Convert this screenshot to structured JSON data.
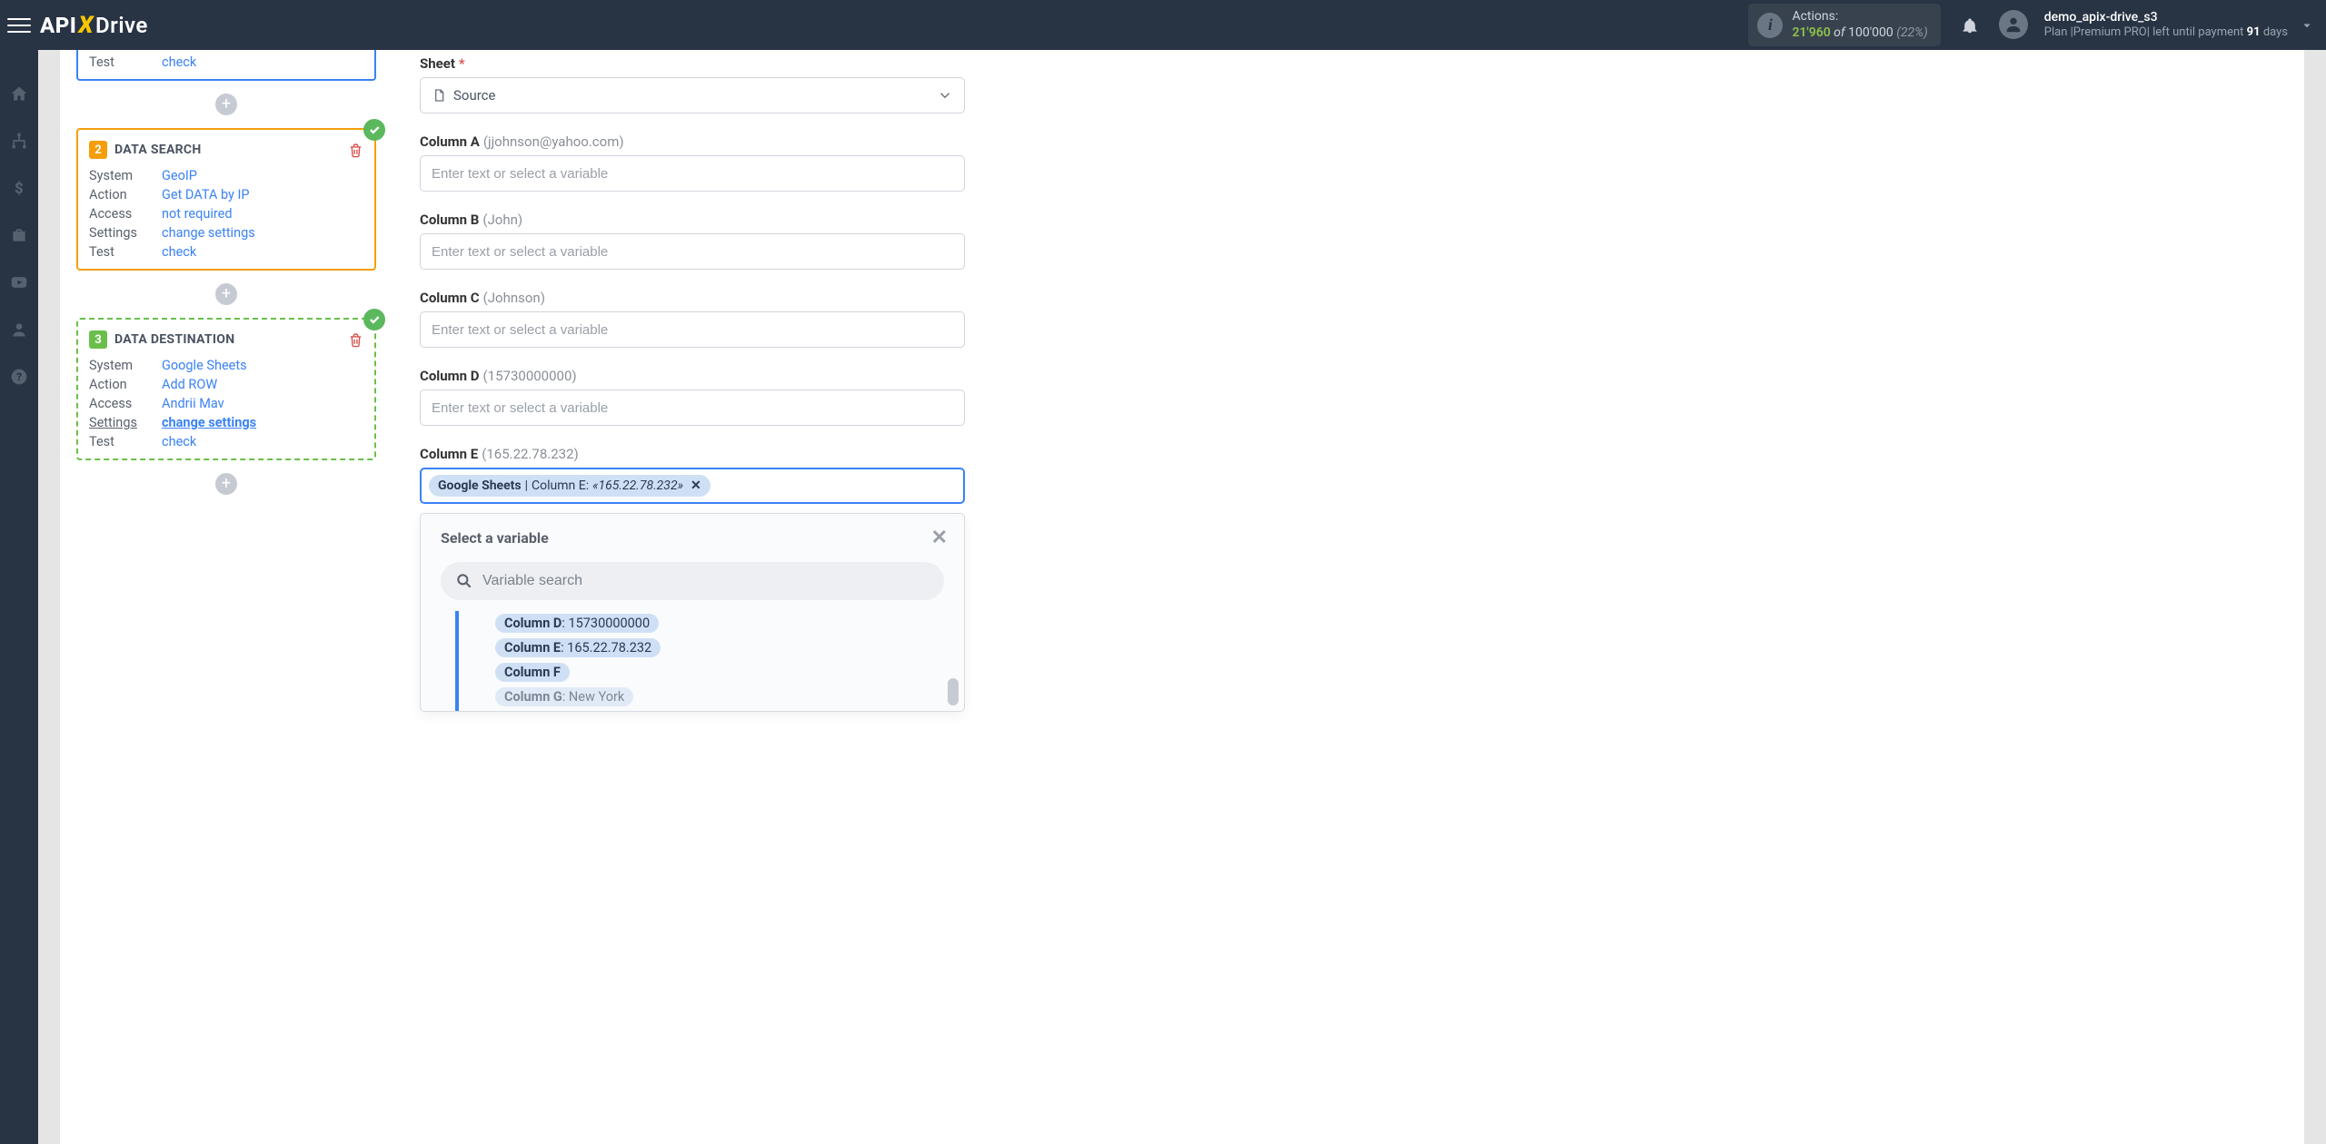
{
  "header": {
    "logo_api": "API",
    "logo_drive": "Drive",
    "actions_label": "Actions:",
    "actions_count": "21'960",
    "actions_of": " of ",
    "actions_total": "100'000",
    "actions_pct": " (22%)",
    "user_name": "demo_apix-drive_s3",
    "user_plan_prefix": "Plan |",
    "user_plan_name": "Premium PRO",
    "user_plan_suffix": "| left until payment ",
    "user_plan_days": "91",
    "user_plan_days_unit": " days"
  },
  "sidebar_icons": [
    "home",
    "sitemap",
    "dollar",
    "briefcase",
    "youtube",
    "user",
    "help"
  ],
  "card1": {
    "test_k": "Test",
    "test_v": "check"
  },
  "card2": {
    "num": "2",
    "title": "DATA SEARCH",
    "rows": {
      "system_k": "System",
      "system_v": "GeoIP",
      "action_k": "Action",
      "action_v": "Get DATA by IP",
      "access_k": "Access",
      "access_v": "not required",
      "settings_k": "Settings",
      "settings_v": "change settings",
      "test_k": "Test",
      "test_v": "check"
    }
  },
  "card3": {
    "num": "3",
    "title": "DATA DESTINATION",
    "rows": {
      "system_k": "System",
      "system_v": "Google Sheets",
      "action_k": "Action",
      "action_v": "Add ROW",
      "access_k": "Access",
      "access_v": "Andrii Mav",
      "settings_k": "Settings",
      "settings_v": "change settings",
      "test_k": "Test",
      "test_v": "check"
    }
  },
  "form": {
    "sheet_label": "Sheet",
    "sheet_value": "Source",
    "placeholder": "Enter text or select a variable",
    "colA_label": "Column A",
    "colA_hint": "(jjohnson@yahoo.com)",
    "colB_label": "Column B",
    "colB_hint": "(John)",
    "colC_label": "Column C",
    "colC_hint": "(Johnson)",
    "colD_label": "Column D",
    "colD_hint": "(15730000000)",
    "colE_label": "Column E",
    "colE_hint": "(165.22.78.232)",
    "chip_source": "Google Sheets",
    "chip_sep": " | ",
    "chip_col": "Column E: ",
    "chip_val": "«165.22.78.232»"
  },
  "dropdown": {
    "title": "Select a variable",
    "search_placeholder": "Variable search",
    "items": [
      {
        "label": "Column D",
        "val": ": 15730000000"
      },
      {
        "label": "Column E",
        "val": ": 165.22.78.232"
      },
      {
        "label": "Column F",
        "val": ""
      },
      {
        "label": "Column G",
        "val": ": New York"
      }
    ]
  }
}
